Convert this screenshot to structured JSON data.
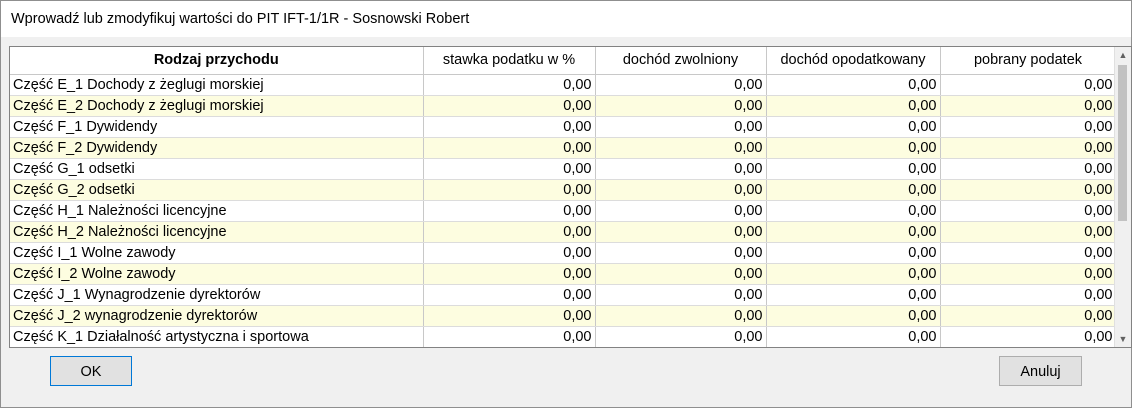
{
  "window": {
    "title": "Wprowadź lub zmodyfikuj wartości do PIT IFT-1/1R - Sosnowski Robert"
  },
  "grid": {
    "columns": [
      "Rodzaj przychodu",
      "stawka podatku w %",
      "dochód zwolniony",
      "dochód opodatkowany",
      "pobrany podatek"
    ],
    "rows": [
      {
        "label": "Część E_1 Dochody z żeglugi morskiej",
        "v": [
          "0,00",
          "0,00",
          "0,00",
          "0,00"
        ]
      },
      {
        "label": "Część E_2 Dochody z żeglugi morskiej",
        "v": [
          "0,00",
          "0,00",
          "0,00",
          "0,00"
        ]
      },
      {
        "label": "Część F_1 Dywidendy",
        "v": [
          "0,00",
          "0,00",
          "0,00",
          "0,00"
        ]
      },
      {
        "label": "Część F_2 Dywidendy",
        "v": [
          "0,00",
          "0,00",
          "0,00",
          "0,00"
        ]
      },
      {
        "label": "Część G_1 odsetki",
        "v": [
          "0,00",
          "0,00",
          "0,00",
          "0,00"
        ]
      },
      {
        "label": "Część G_2 odsetki",
        "v": [
          "0,00",
          "0,00",
          "0,00",
          "0,00"
        ]
      },
      {
        "label": "Część H_1 Należności licencyjne",
        "v": [
          "0,00",
          "0,00",
          "0,00",
          "0,00"
        ]
      },
      {
        "label": "Część H_2 Należności licencyjne",
        "v": [
          "0,00",
          "0,00",
          "0,00",
          "0,00"
        ]
      },
      {
        "label": "Część I_1 Wolne zawody",
        "v": [
          "0,00",
          "0,00",
          "0,00",
          "0,00"
        ]
      },
      {
        "label": "Część I_2 Wolne zawody",
        "v": [
          "0,00",
          "0,00",
          "0,00",
          "0,00"
        ]
      },
      {
        "label": "Część J_1 Wynagrodzenie dyrektorów",
        "v": [
          "0,00",
          "0,00",
          "0,00",
          "0,00"
        ]
      },
      {
        "label": "Część J_2 wynagrodzenie dyrektorów",
        "v": [
          "0,00",
          "0,00",
          "0,00",
          "0,00"
        ]
      },
      {
        "label": "Część K_1 Działalność artystyczna i sportowa",
        "v": [
          "0,00",
          "0,00",
          "0,00",
          "0,00"
        ]
      }
    ]
  },
  "buttons": {
    "ok": "OK",
    "cancel": "Anuluj"
  },
  "icons": {
    "scroll_up": "chevron-up-icon",
    "scroll_down": "chevron-down-icon"
  }
}
